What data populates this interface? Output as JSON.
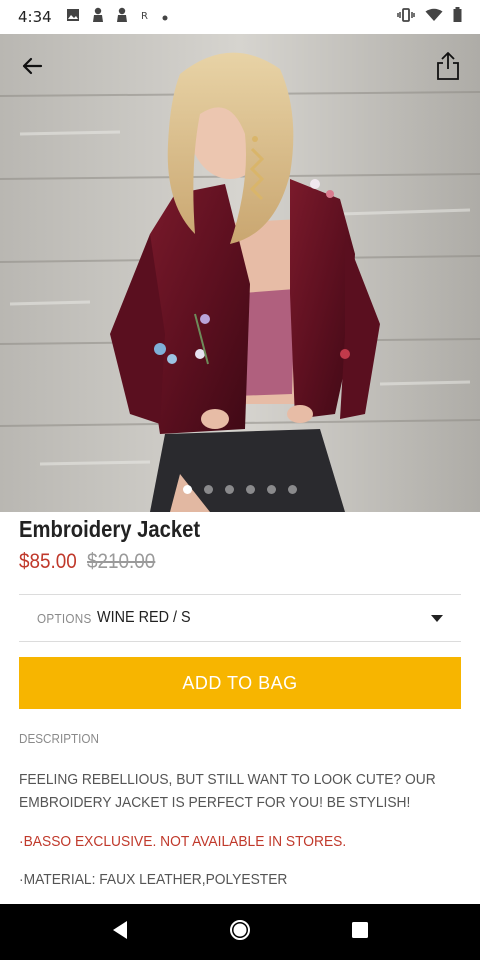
{
  "status_bar": {
    "time": "4:34",
    "left_icons": [
      "image-icon",
      "notification-person-icon",
      "notification-person-icon",
      "r-icon",
      "dot-icon"
    ],
    "right_icons": [
      "vibrate-icon",
      "wifi-icon",
      "battery-icon"
    ]
  },
  "hero": {
    "image_desc": "product-photo",
    "carousel_dot_count": 6,
    "carousel_active_index": 0
  },
  "product": {
    "title": "Embroidery Jacket",
    "sale_price": "$85.00",
    "original_price": "$210.00"
  },
  "options": {
    "label": "OPTIONS",
    "value": "WINE RED / S"
  },
  "cta": {
    "label": "ADD TO BAG",
    "color": "#f7b500"
  },
  "description": {
    "heading": "DESCRIPTION",
    "body": "FEELING REBELLIOUS, BUT STILL WANT TO LOOK CUTE? OUR EMBROIDERY JACKET IS PERFECT FOR YOU! BE STYLISH!",
    "exclusive": "·BASSO EXCLUSIVE. NOT AVAILABLE IN STORES.",
    "material": "·MATERIAL: FAUX LEATHER,POLYESTER"
  },
  "colors": {
    "sale_price": "#c0392b",
    "accent": "#f7b500"
  }
}
